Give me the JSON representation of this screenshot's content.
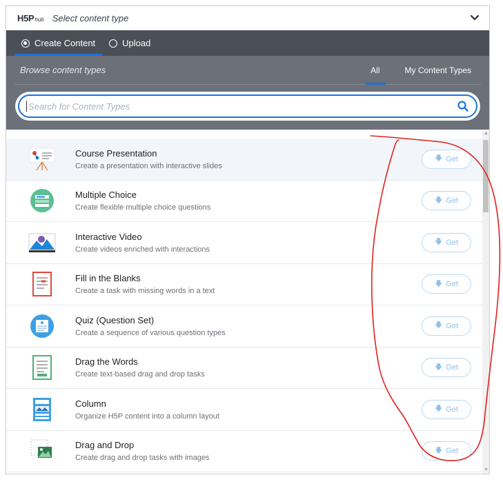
{
  "header": {
    "logo_main": "H5P",
    "logo_sub": "hub",
    "title": "Select content type"
  },
  "modes": [
    {
      "label": "Create Content",
      "selected": true
    },
    {
      "label": "Upload",
      "selected": false
    }
  ],
  "browse": {
    "title": "Browse content types",
    "filters": [
      "All",
      "My Content Types"
    ],
    "active_filter": "All"
  },
  "search": {
    "placeholder": "Search for Content Types",
    "value": ""
  },
  "get_label": "Get",
  "content_types": [
    {
      "title": "Course Presentation",
      "description": "Create a presentation with interactive slides",
      "icon": "course-presentation-icon"
    },
    {
      "title": "Multiple Choice",
      "description": "Create flexible multiple choice questions",
      "icon": "multiple-choice-icon"
    },
    {
      "title": "Interactive Video",
      "description": "Create videos enriched with interactions",
      "icon": "interactive-video-icon"
    },
    {
      "title": "Fill in the Blanks",
      "description": "Create a task with missing words in a text",
      "icon": "fill-in-the-blanks-icon"
    },
    {
      "title": "Quiz (Question Set)",
      "description": "Create a sequence of various question types",
      "icon": "quiz-icon"
    },
    {
      "title": "Drag the Words",
      "description": "Create text-based drag and drop tasks",
      "icon": "drag-the-words-icon"
    },
    {
      "title": "Column",
      "description": "Organize H5P content into a column layout",
      "icon": "column-icon"
    },
    {
      "title": "Drag and Drop",
      "description": "Create drag and drop tasks with images",
      "icon": "drag-and-drop-icon"
    }
  ],
  "colors": {
    "accent": "#1a73d9",
    "mode_bar": "#4b5058",
    "browse_panel": "#6b7079",
    "get_button": "#8fc1ea",
    "annotation": "#e0201b"
  }
}
